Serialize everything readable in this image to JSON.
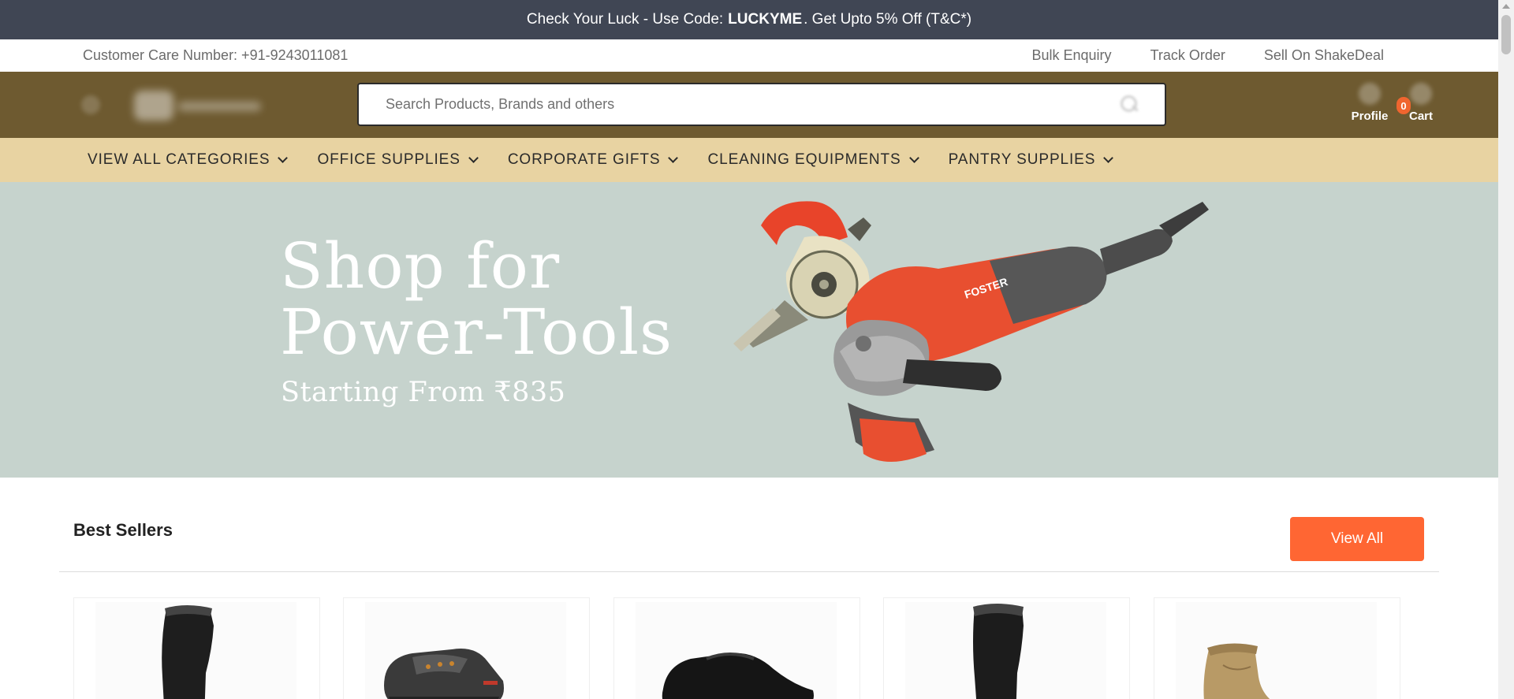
{
  "promo": {
    "text_before": "Check Your Luck - Use Code:",
    "code": "LUCKYME",
    "text_after": ". Get Upto 5% Off (T&C*)"
  },
  "utility": {
    "customer_care": "Customer Care Number: +91-9243011081",
    "links": [
      "Bulk Enquiry",
      "Track Order",
      "Sell On ShakeDeal"
    ]
  },
  "header": {
    "search_placeholder": "Search Products, Brands and others",
    "profile_label": "Profile",
    "cart_label": "Cart",
    "cart_count": "0",
    "background_color": "#6e5a30"
  },
  "categories": [
    "VIEW ALL CATEGORIES",
    "OFFICE SUPPLIES",
    "CORPORATE GIFTS",
    "CLEANING EQUIPMENTS",
    "PANTRY SUPPLIES"
  ],
  "banner": {
    "line1": "Shop for",
    "line2": "Power-Tools",
    "subline": "Starting From ₹835",
    "brand_on_tool": "FOSTER",
    "background_color": "#c6d3cd"
  },
  "best_sellers": {
    "title": "Best Sellers",
    "view_all_label": "View All",
    "accent_color": "#ff6633",
    "products": [
      {
        "icon": "gumboot-icon"
      },
      {
        "icon": "safety-shoe-icon"
      },
      {
        "icon": "formal-shoe-icon"
      },
      {
        "icon": "gumboot-icon"
      },
      {
        "icon": "tan-boot-icon"
      }
    ]
  }
}
